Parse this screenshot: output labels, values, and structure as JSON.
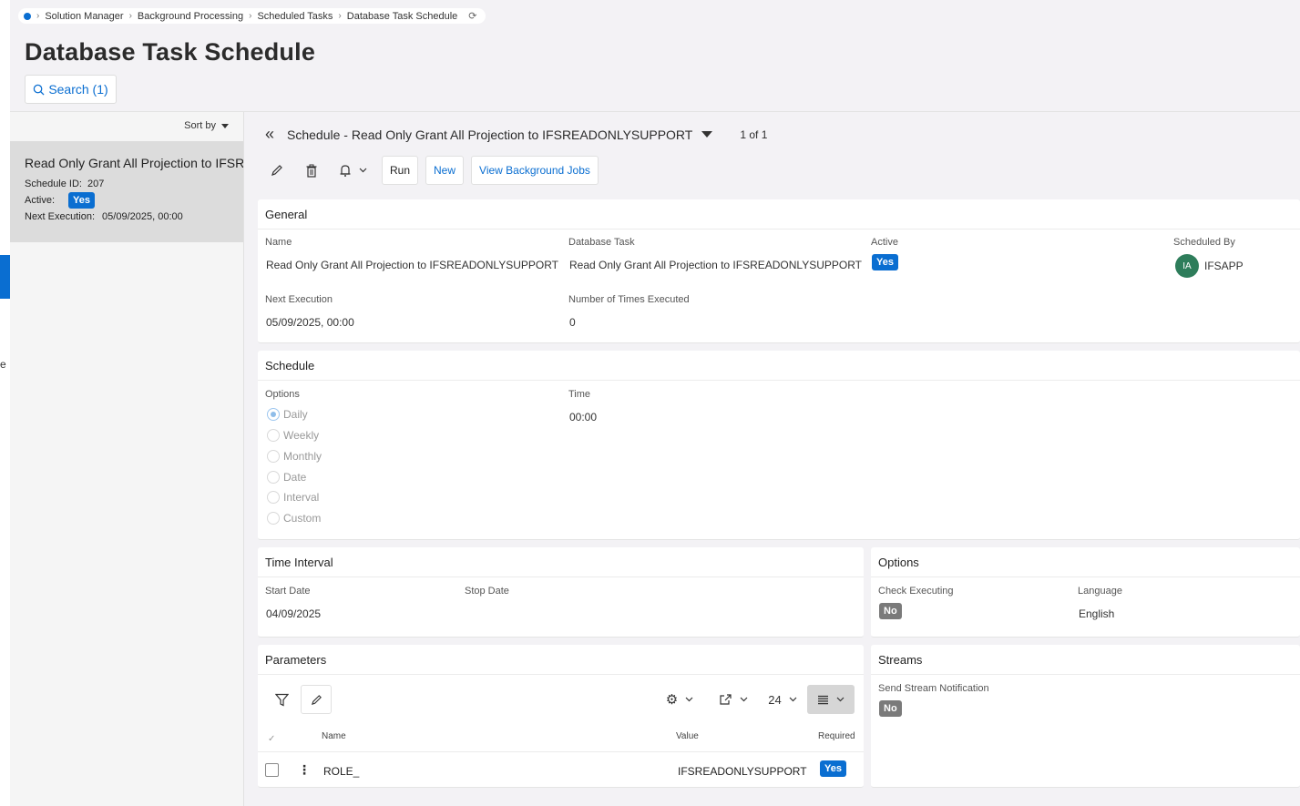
{
  "breadcrumb": {
    "items": [
      "Solution Manager",
      "Background Processing",
      "Scheduled Tasks",
      "Database Task Schedule"
    ]
  },
  "page": {
    "title": "Database Task Schedule",
    "search_label": "Search (1)"
  },
  "list": {
    "sort_label": "Sort by",
    "card": {
      "title": "Read Only Grant All Projection to IFSREADONLYSUPPORT",
      "schedule_id_label": "Schedule ID:",
      "schedule_id": "207",
      "active_label": "Active:",
      "active_value": "Yes",
      "next_label": "Next Execution:",
      "next_value": "05/09/2025, 00:00"
    }
  },
  "detail": {
    "title": "Schedule - Read Only Grant All Projection to IFSREADONLYSUPPORT",
    "counter": "1 of 1",
    "toolbar": {
      "run": "Run",
      "new": "New",
      "view_jobs": "View Background Jobs"
    }
  },
  "general": {
    "title": "General",
    "name_label": "Name",
    "name_value": "Read Only Grant All Projection to IFSREADONLYSUPPORT",
    "task_label": "Database Task",
    "task_value": "Read Only Grant All Projection to IFSREADONLYSUPPORT",
    "active_label": "Active",
    "active_value": "Yes",
    "scheduled_by_label": "Scheduled By",
    "scheduled_by_initials": "IA",
    "scheduled_by_value": "IFSAPP",
    "next_label": "Next Execution",
    "next_value": "05/09/2025, 00:00",
    "times_label": "Number of Times Executed",
    "times_value": "0"
  },
  "schedule": {
    "title": "Schedule",
    "options_label": "Options",
    "options": [
      "Daily",
      "Weekly",
      "Monthly",
      "Date",
      "Interval",
      "Custom"
    ],
    "selected": "Daily",
    "time_label": "Time",
    "time_value": "00:00"
  },
  "time_interval": {
    "title": "Time Interval",
    "start_label": "Start Date",
    "start_value": "04/09/2025",
    "stop_label": "Stop Date"
  },
  "options": {
    "title": "Options",
    "check_label": "Check Executing",
    "check_value": "No",
    "language_label": "Language",
    "language_value": "English"
  },
  "parameters": {
    "title": "Parameters",
    "page_size": "24",
    "columns": [
      "Name",
      "Value",
      "Required"
    ],
    "rows": [
      {
        "name": "ROLE_",
        "value": "IFSREADONLYSUPPORT",
        "required": "Yes"
      }
    ]
  },
  "streams": {
    "title": "Streams",
    "notify_label": "Send Stream Notification",
    "notify_value": "No"
  }
}
